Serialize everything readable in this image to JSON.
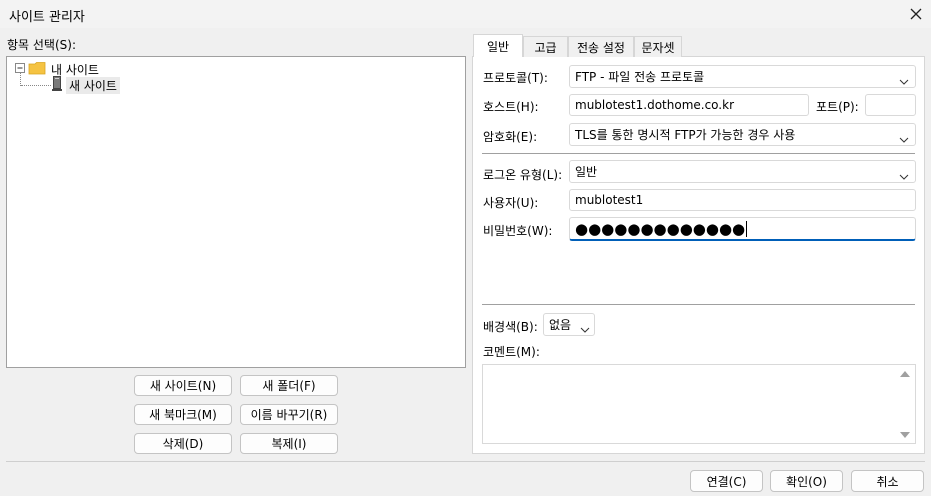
{
  "window": {
    "title": "사이트 관리자"
  },
  "left": {
    "select_label": "항목 선택(S):",
    "tree": {
      "root": "내 사이트",
      "child": "새 사이트"
    },
    "buttons": {
      "new_site": "새 사이트(N)",
      "new_folder": "새 폴더(F)",
      "new_bookmark": "새 북마크(M)",
      "rename": "이름 바꾸기(R)",
      "delete": "삭제(D)",
      "duplicate": "복제(I)"
    }
  },
  "tabs": [
    "일반",
    "고급",
    "전송 설정",
    "문자셋"
  ],
  "general": {
    "protocol_label": "프로토콜(T):",
    "protocol_value": "FTP - 파일 전송 프로토콜",
    "host_label": "호스트(H):",
    "host_value": "mublotest1.dothome.co.kr",
    "port_label": "포트(P):",
    "port_value": "",
    "encryption_label": "암호화(E):",
    "encryption_value": "TLS를 통한 명시적 FTP가 가능한 경우 사용",
    "logon_label": "로그온 유형(L):",
    "logon_value": "일반",
    "user_label": "사용자(U):",
    "user_value": "mublotest1",
    "password_label": "비밀번호(W):",
    "password_mask": "●●●●●●●●●●●●●",
    "bg_label": "배경색(B):",
    "bg_value": "없음",
    "comment_label": "코멘트(M):"
  },
  "footer": {
    "connect": "연결(C)",
    "ok": "확인(O)",
    "cancel": "취소"
  },
  "colors": {
    "accent": "#005fb8",
    "folder": "#f5c342"
  }
}
